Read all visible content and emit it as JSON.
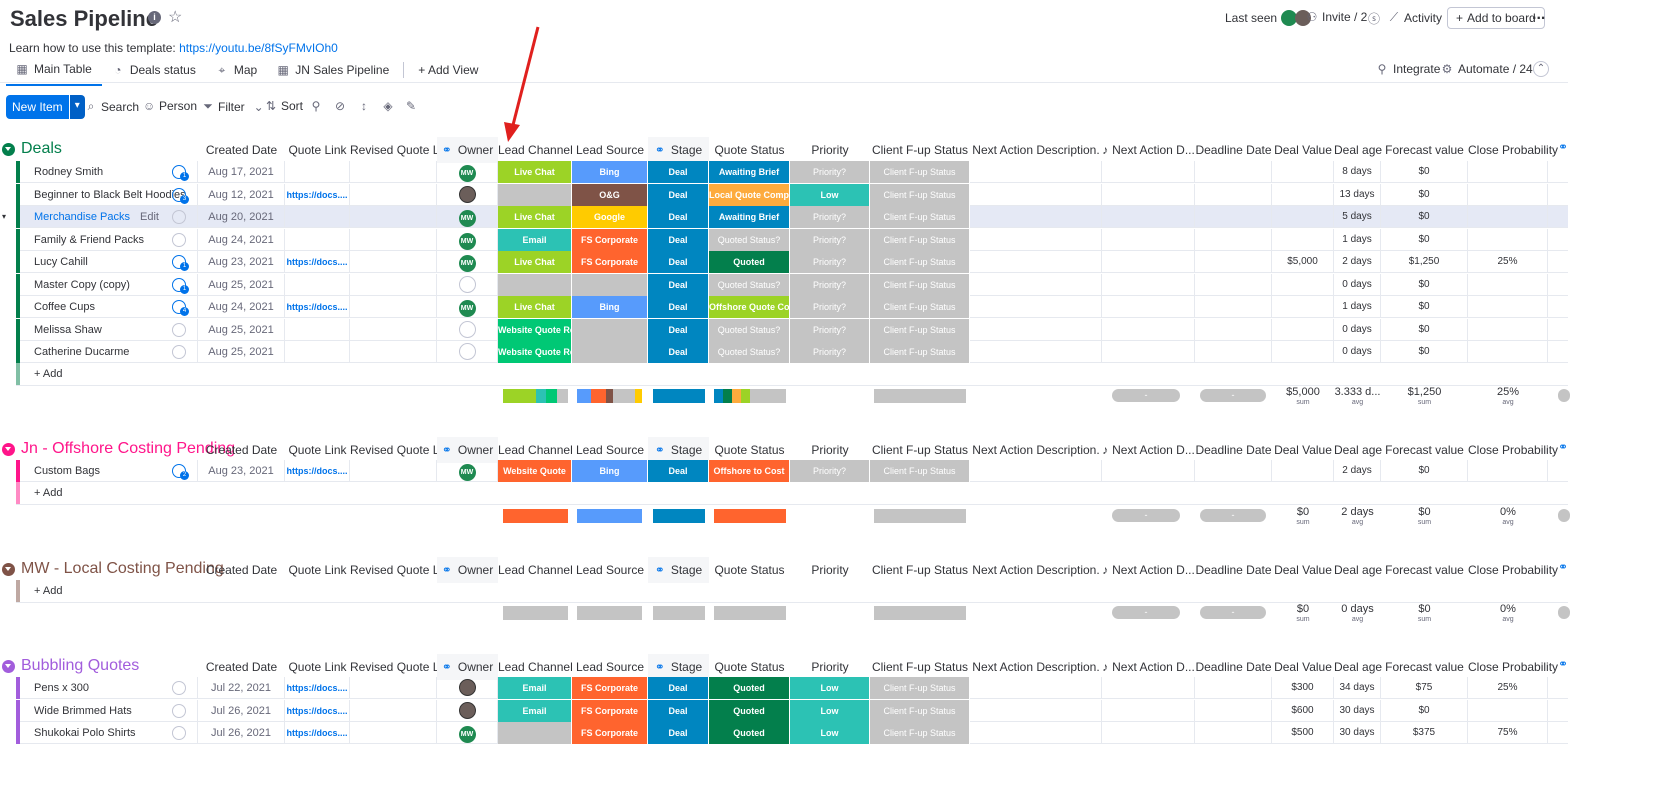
{
  "header": {
    "title": "Sales Pipeline",
    "learn_text": "Learn how to use this template:",
    "learn_link": "https://youtu.be/8fSyFMvIOh0",
    "last_seen": "Last seen",
    "invite": "Invite / 2",
    "activity": "Activity",
    "add_to_board": "Add to board",
    "more": "..."
  },
  "tabs": [
    {
      "label": "Main Table",
      "icon": "table-icon"
    },
    {
      "label": "Deals status",
      "icon": "chart-icon"
    },
    {
      "label": "Map",
      "icon": "map-pin-icon"
    },
    {
      "label": "JN Sales Pipeline",
      "icon": "table-icon"
    },
    {
      "label": "+ Add View",
      "icon": ""
    }
  ],
  "integrate": "Integrate",
  "automate": "Automate / 24",
  "toolbar": {
    "new_item": "New Item",
    "search": "Search",
    "person": "Person",
    "filter": "Filter",
    "sort": "Sort"
  },
  "columns": [
    "Created Date",
    "Quote Link",
    "Revised Quote Link",
    "Owner",
    "Lead Channel",
    "Lead Source",
    "Stage",
    "Quote Status",
    "Priority",
    "Client F-up Status",
    "Next Action Description.",
    "Next Action D...",
    "Deadline Date",
    "Deal Value",
    "Deal age",
    "Forecast value",
    "Close Probability"
  ],
  "groups": {
    "deals": {
      "title": "Deals",
      "add": "+ Add",
      "rows": [
        {
          "name": "Rodney Smith",
          "badge": "1",
          "date": "Aug 17, 2021",
          "link": "",
          "owner": "MW",
          "channel": "Live Chat",
          "source": "Bing",
          "stage": "Deal",
          "quote": "Awaiting Brief",
          "priority": "Priority?",
          "fup": "Client F-up Status",
          "value": "",
          "age": "8 days",
          "forecast": "$0",
          "prob": ""
        },
        {
          "name": "Beginner to Black Belt Hoodies",
          "badge": "3",
          "date": "Aug 12, 2021",
          "link": "https://docs....",
          "owner": "face",
          "channel": "",
          "source": "O&G",
          "stage": "Deal",
          "quote": "Local Quote Compl...",
          "priority": "Low",
          "fup": "Client F-up Status",
          "value": "",
          "age": "13 days",
          "forecast": "$0",
          "prob": ""
        },
        {
          "name": "Merchandise Packs",
          "edit": "Edit",
          "badge": "",
          "date": "Aug 20, 2021",
          "link": "",
          "owner": "MW",
          "channel": "Live Chat",
          "source": "Google",
          "stage": "Deal",
          "quote": "Awaiting Brief",
          "priority": "Priority?",
          "fup": "Client F-up Status",
          "value": "",
          "age": "5 days",
          "forecast": "$0",
          "prob": ""
        },
        {
          "name": "Family & Friend Packs",
          "badge": "",
          "date": "Aug 24, 2021",
          "link": "",
          "owner": "MW",
          "channel": "Email",
          "source": "FS Corporate",
          "stage": "Deal",
          "quote": "Quoted Status?",
          "priority": "Priority?",
          "fup": "Client F-up Status",
          "value": "",
          "age": "1 days",
          "forecast": "$0",
          "prob": ""
        },
        {
          "name": "Lucy Cahill",
          "badge": "1",
          "date": "Aug 23, 2021",
          "link": "https://docs....",
          "owner": "MW",
          "channel": "Live Chat",
          "source": "FS Corporate",
          "stage": "Deal",
          "quote": "Quoted",
          "priority": "Priority?",
          "fup": "Client F-up Status",
          "value": "$5,000",
          "age": "2 days",
          "forecast": "$1,250",
          "prob": "25%"
        },
        {
          "name": "Master Copy (copy)",
          "badge": "1",
          "date": "Aug 25, 2021",
          "link": "",
          "owner": "",
          "channel": "",
          "source": "",
          "stage": "Deal",
          "quote": "Quoted Status?",
          "priority": "Priority?",
          "fup": "Client F-up Status",
          "value": "",
          "age": "0 days",
          "forecast": "$0",
          "prob": ""
        },
        {
          "name": "Coffee Cups",
          "badge": "4",
          "date": "Aug 24, 2021",
          "link": "https://docs....",
          "owner": "MW",
          "channel": "Live Chat",
          "source": "Bing",
          "stage": "Deal",
          "quote": "Offshore Quote Co...",
          "priority": "Priority?",
          "fup": "Client F-up Status",
          "value": "",
          "age": "1 days",
          "forecast": "$0",
          "prob": ""
        },
        {
          "name": "Melissa Shaw",
          "badge": "",
          "date": "Aug 25, 2021",
          "link": "",
          "owner": "",
          "channel": "Website Quote Req",
          "source": "",
          "stage": "Deal",
          "quote": "Quoted Status?",
          "priority": "Priority?",
          "fup": "Client F-up Status",
          "value": "",
          "age": "0 days",
          "forecast": "$0",
          "prob": ""
        },
        {
          "name": "Catherine Ducarme",
          "badge": "",
          "date": "Aug 25, 2021",
          "link": "",
          "owner": "",
          "channel": "Website Quote Req",
          "source": "",
          "stage": "Deal",
          "quote": "Quoted Status?",
          "priority": "Priority?",
          "fup": "Client F-up Status",
          "value": "",
          "age": "0 days",
          "forecast": "$0",
          "prob": ""
        }
      ],
      "summary": {
        "value": "$5,000",
        "value_sub": "sum",
        "age": "3.333 d...",
        "age_sub": "avg",
        "forecast": "$1,250",
        "forecast_sub": "sum",
        "prob": "25%",
        "prob_sub": "avg"
      }
    },
    "offshore": {
      "title": "Jn - Offshore Costing Pending",
      "add": "+ Add",
      "rows": [
        {
          "name": "Custom Bags",
          "badge": "2",
          "date": "Aug 23, 2021",
          "link": "https://docs....",
          "owner": "MW",
          "channel": "Website Quote",
          "source": "Bing",
          "stage": "Deal",
          "quote": "Offshore to Cost",
          "priority": "Priority?",
          "fup": "Client F-up Status",
          "value": "",
          "age": "2 days",
          "forecast": "$0",
          "prob": ""
        }
      ],
      "summary": {
        "value": "$0",
        "value_sub": "sum",
        "age": "2 days",
        "age_sub": "avg",
        "forecast": "$0",
        "forecast_sub": "sum",
        "prob": "0%",
        "prob_sub": "avg"
      }
    },
    "local": {
      "title": "MW - Local Costing Pending",
      "add": "+ Add",
      "summary": {
        "value": "$0",
        "value_sub": "sum",
        "age": "0 days",
        "age_sub": "avg",
        "forecast": "$0",
        "forecast_sub": "sum",
        "prob": "0%",
        "prob_sub": "avg"
      }
    },
    "bubbling": {
      "title": "Bubbling Quotes",
      "rows": [
        {
          "name": "Pens x 300",
          "date": "Jul 22, 2021",
          "link": "https://docs....",
          "owner": "face",
          "channel": "Email",
          "source": "FS Corporate",
          "stage": "Deal",
          "quote": "Quoted",
          "priority": "Low",
          "fup": "Client F-up Status",
          "value": "$300",
          "age": "34 days",
          "forecast": "$75",
          "prob": "25%"
        },
        {
          "name": "Wide Brimmed Hats",
          "date": "Jul 26, 2021",
          "link": "https://docs....",
          "owner": "face",
          "channel": "Email",
          "source": "FS Corporate",
          "stage": "Deal",
          "quote": "Quoted",
          "priority": "Low",
          "fup": "Client F-up Status",
          "value": "$600",
          "age": "30 days",
          "forecast": "$0",
          "prob": ""
        },
        {
          "name": "Shukokai Polo Shirts",
          "date": "Jul 26, 2021",
          "link": "https://docs....",
          "owner": "MW",
          "channel": "",
          "source": "FS Corporate",
          "stage": "Deal",
          "quote": "Quoted",
          "priority": "Low",
          "fup": "Client F-up Status",
          "value": "$500",
          "age": "30 days",
          "forecast": "$375",
          "prob": "75%"
        }
      ]
    }
  },
  "summary_dash": "-",
  "colors": {
    "deals": "#037f4c",
    "offshore": "#ff158a",
    "local": "#7f5347",
    "bubbling": "#a25ddc",
    "accent": "#0073ea",
    "live_chat": "#9cd326",
    "email": "#2cc2b4",
    "website": "#00c875",
    "website_quote": "#ff642e",
    "bing": "#579bfc",
    "og": "#7f5347",
    "google": "#ffcb00",
    "fs_corporate": "#ff642e",
    "deal": "#0086c0",
    "awaiting": "#0086c0",
    "local_quote": "#fdab3d",
    "quoted": "#037f4c",
    "offshore_quote": "#9cd326",
    "offshore_cost": "#ff642e",
    "grey": "#c4c4c4",
    "low": "#2cc2b4"
  }
}
